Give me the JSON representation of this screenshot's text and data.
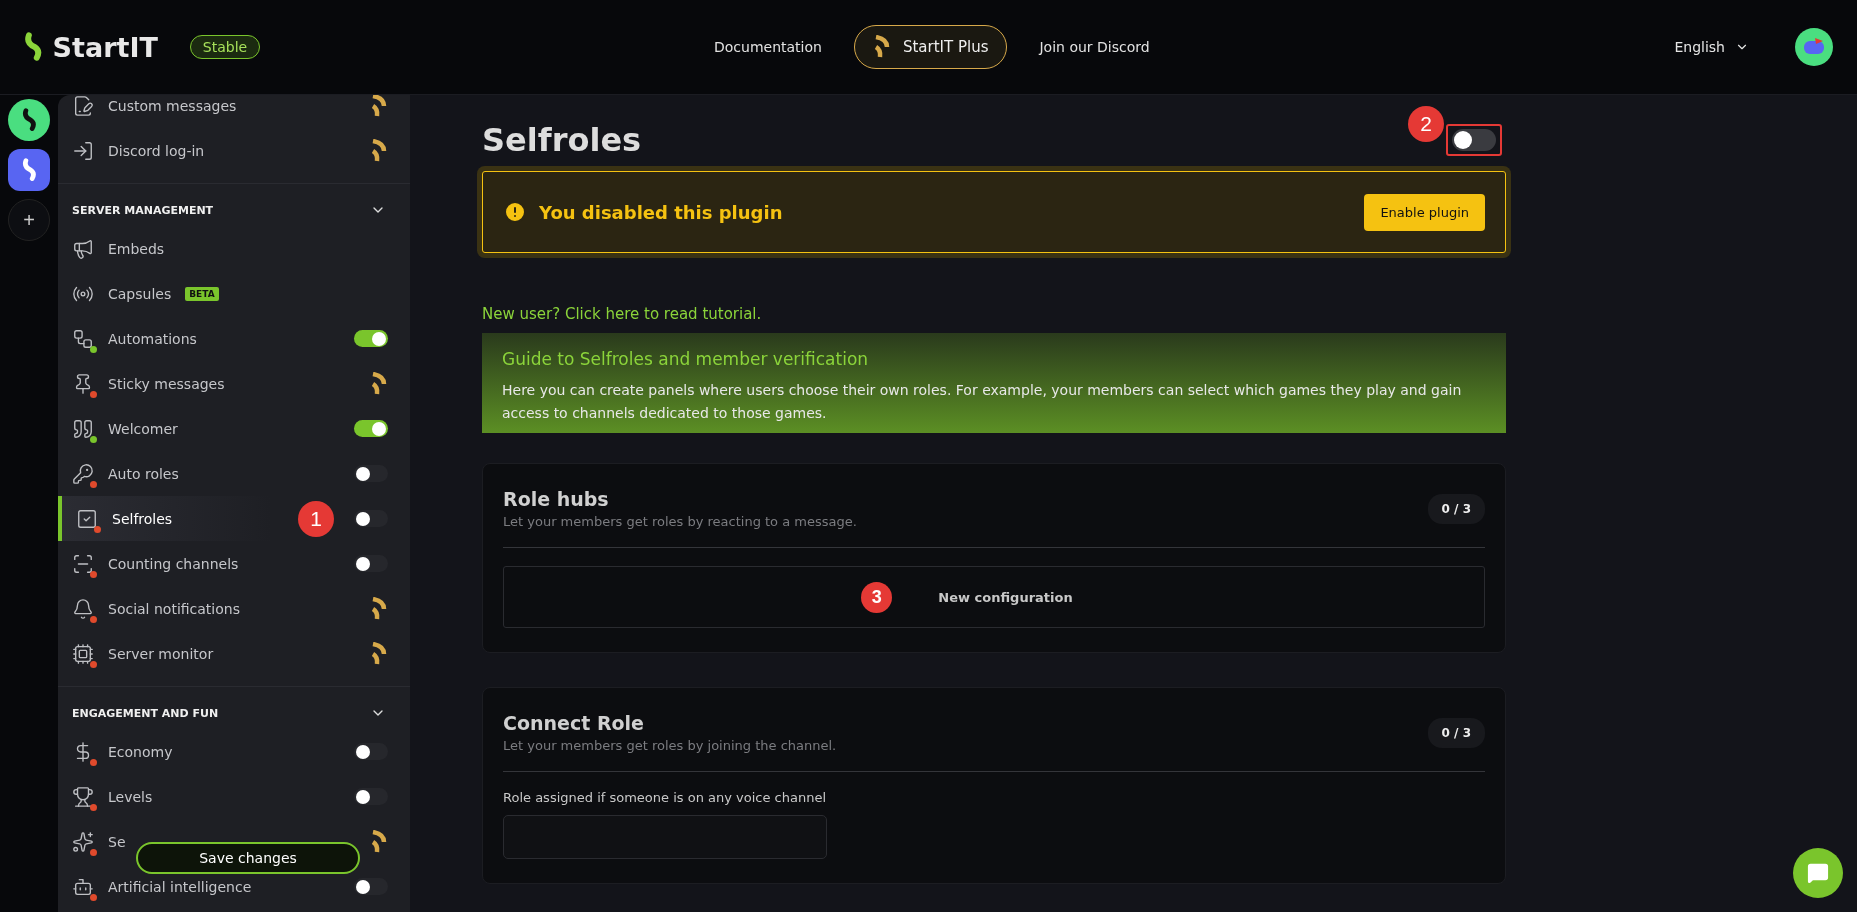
{
  "header": {
    "brand": "StartIT",
    "channel_badge": "Stable",
    "nav": [
      {
        "label": "Documentation",
        "kind": "link"
      },
      {
        "label": "StartIT Plus",
        "kind": "plus"
      },
      {
        "label": "Join our Discord",
        "kind": "link"
      }
    ],
    "language": "English"
  },
  "server_rail": [
    {
      "kind": "server",
      "color": "#4ade80",
      "selected": false
    },
    {
      "kind": "server",
      "color": "#5865f2",
      "selected": true
    },
    {
      "kind": "add",
      "label": "+"
    }
  ],
  "sidebar": {
    "sections": [
      {
        "items": [
          {
            "label": "Custom messages",
            "kind": "plus",
            "selected": false
          },
          {
            "label": "Discord log-in",
            "kind": "plus",
            "selected": false
          }
        ]
      },
      {
        "title": "SERVER MANAGEMENT",
        "expanded": true,
        "items": [
          {
            "label": "Embeds",
            "kind": "none",
            "selected": false
          },
          {
            "label": "Capsules",
            "kind": "none",
            "badge": "BETA",
            "selected": false
          },
          {
            "label": "Automations",
            "kind": "toggle",
            "on": true,
            "color": "#7ac52c",
            "selected": false
          },
          {
            "label": "Sticky messages",
            "kind": "plus",
            "color": "#e04a2c",
            "selected": false
          },
          {
            "label": "Welcomer",
            "kind": "toggle",
            "on": true,
            "color": "#7ac52c",
            "selected": false
          },
          {
            "label": "Auto roles",
            "kind": "toggle",
            "on": false,
            "color": "#e04a2c",
            "selected": false
          },
          {
            "label": "Selfroles",
            "kind": "toggle",
            "on": false,
            "color": "#e04a2c",
            "selected": true,
            "marker": "1"
          },
          {
            "label": "Counting channels",
            "kind": "toggle",
            "on": false,
            "color": "#e04a2c",
            "selected": false
          },
          {
            "label": "Social notifications",
            "kind": "plus",
            "color": "#e04a2c",
            "selected": false
          },
          {
            "label": "Server monitor",
            "kind": "plus",
            "color": "#e04a2c",
            "selected": false
          }
        ]
      },
      {
        "title": "ENGAGEMENT AND FUN",
        "expanded": true,
        "items": [
          {
            "label": "Economy",
            "kind": "toggle",
            "on": false,
            "color": "#e04a2c",
            "selected": false
          },
          {
            "label": "Levels",
            "kind": "toggle",
            "on": false,
            "color": "#e04a2c",
            "selected": false
          },
          {
            "label": "Se",
            "kind": "plus",
            "color": "#e04a2c",
            "selected": false
          },
          {
            "label": "Artificial intelligence",
            "kind": "toggle",
            "on": false,
            "color": "#e04a2c",
            "selected": false
          }
        ]
      }
    ],
    "save_button": "Save changes"
  },
  "page": {
    "title": "Selfroles",
    "enabled": false,
    "toggle_marker": "2",
    "banner": {
      "message": "You disabled this plugin",
      "action": "Enable plugin"
    },
    "tutorial_link": "New user? Click here to read tutorial.",
    "guide": {
      "title": "Guide to Selfroles and member verification",
      "text": "Here you can create panels where users choose their own roles. For example, your members can select which games they play and gain access to channels dedicated to those games."
    },
    "cards": [
      {
        "title": "Role hubs",
        "subtitle": "Let your members get roles by reacting to a message.",
        "count": "0 / 3",
        "kind": "button",
        "action": "New configuration",
        "marker": "3"
      },
      {
        "title": "Connect Role",
        "subtitle": "Let your members get roles by joining the channel.",
        "count": "0 / 3",
        "kind": "field",
        "field_label": "Role assigned if someone is on any voice channel"
      }
    ]
  }
}
